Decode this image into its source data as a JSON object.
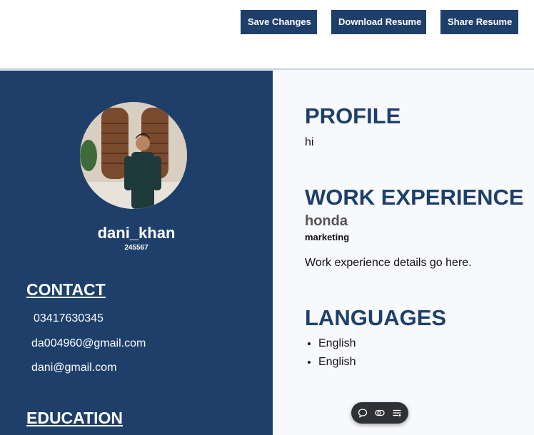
{
  "toolbar": {
    "save_label": "Save Changes",
    "download_label": "Download Resume",
    "share_label": "Share Resume"
  },
  "sidebar": {
    "name": "dani_khan",
    "user_id": "245567",
    "contact_title": "CONTACT",
    "phone": "03417630345",
    "email_1": "da004960@gmail.com",
    "email_2": "dani@gmail.com",
    "education_title": "EDUCATION"
  },
  "main": {
    "profile_title": "PROFILE",
    "profile_text": "hi",
    "work_title": "WORK EXPERIENCE",
    "company": "honda",
    "role": "marketing",
    "work_details": "Work experience details go here.",
    "languages_title": "LANGUAGES",
    "languages": [
      "English",
      "English"
    ]
  },
  "floating_toolbar": {
    "icons": [
      "comment-icon",
      "toggle-icon",
      "menu-lines-icon"
    ]
  },
  "colors": {
    "brand_navy": "#1e3f6a",
    "main_background": "#f8f9fc",
    "floating_bar": "#2f3136"
  }
}
